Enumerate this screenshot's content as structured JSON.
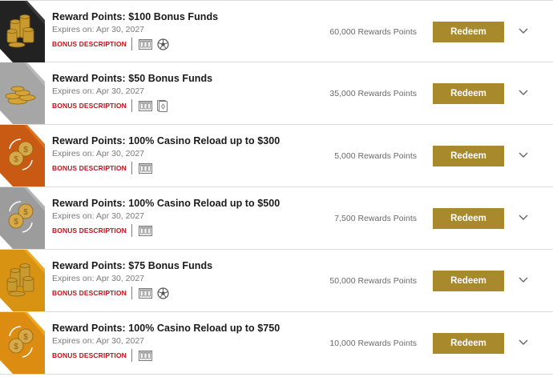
{
  "rewards": [
    {
      "title": "Reward Points: $100 Bonus Funds",
      "expires": "Expires on: Apr 30, 2027",
      "bonus_label": "BONUS DESCRIPTION",
      "points": "60,000 Rewards Points",
      "redeem_label": "Redeem",
      "thumb": "coins-stack",
      "thumb_color": "#3a3a3a",
      "icons": [
        "slots-icon",
        "soccer-ball-icon"
      ]
    },
    {
      "title": "Reward Points: $50 Bonus Funds",
      "expires": "Expires on: Apr 30, 2027",
      "bonus_label": "BONUS DESCRIPTION",
      "points": "35,000 Rewards Points",
      "redeem_label": "Redeem",
      "thumb": "coins-pile",
      "thumb_color": "#b9b9b9",
      "icons": [
        "slots-icon",
        "playing-card-icon"
      ]
    },
    {
      "title": "Reward Points: 100% Casino Reload up to $300",
      "expires": "Expires on: Apr 30, 2027",
      "bonus_label": "BONUS DESCRIPTION",
      "points": "5,000 Rewards Points",
      "redeem_label": "Redeem",
      "thumb": "coin-reload",
      "thumb_color": "#e0701e",
      "icons": [
        "slots-icon"
      ]
    },
    {
      "title": "Reward Points: 100% Casino Reload up to $500",
      "expires": "Expires on: Apr 30, 2027",
      "bonus_label": "BONUS DESCRIPTION",
      "points": "7,500 Rewards Points",
      "redeem_label": "Redeem",
      "thumb": "coin-reload",
      "thumb_color": "#b3b3b3",
      "icons": [
        "slots-icon"
      ]
    },
    {
      "title": "Reward Points: $75 Bonus Funds",
      "expires": "Expires on: Apr 30, 2027",
      "bonus_label": "BONUS DESCRIPTION",
      "points": "50,000 Rewards Points",
      "redeem_label": "Redeem",
      "thumb": "coins-stack",
      "thumb_color": "#eba91f",
      "icons": [
        "slots-icon",
        "soccer-ball-icon"
      ]
    },
    {
      "title": "Reward Points: 100% Casino Reload up to $750",
      "expires": "Expires on: Apr 30, 2027",
      "bonus_label": "BONUS DESCRIPTION",
      "points": "10,000 Rewards Points",
      "redeem_label": "Redeem",
      "thumb": "coin-reload",
      "thumb_color": "#f0a21e",
      "icons": [
        "slots-icon"
      ]
    }
  ],
  "colors": {
    "accent": "#a8892c",
    "bonus_red": "#c3121c"
  }
}
